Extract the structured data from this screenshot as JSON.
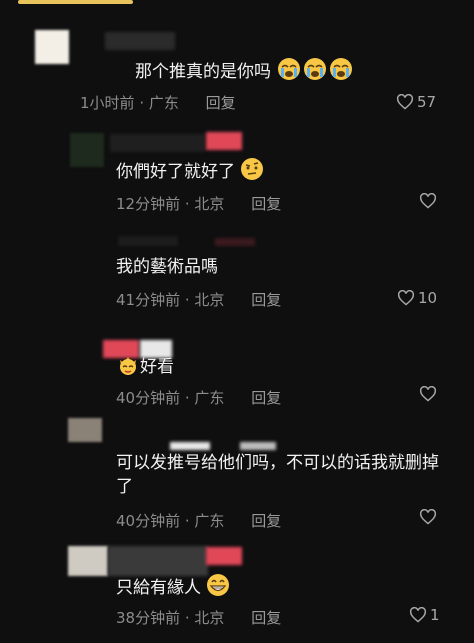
{
  "comments": [
    {
      "text": "那个推真的是你吗",
      "meta_time": "1小时前",
      "meta_location": "· 广东",
      "reply_label": "回复",
      "likes": "57"
    },
    {
      "text": "你們好了就好了",
      "meta_time": "12分钟前",
      "meta_location": "· 北京",
      "reply_label": "回复",
      "likes": ""
    },
    {
      "text": "我的藝術品嗎",
      "meta_time": "41分钟前",
      "meta_location": "· 北京",
      "reply_label": "回复",
      "likes": "10"
    },
    {
      "text": "好看",
      "meta_time": "40分钟前",
      "meta_location": "· 广东",
      "reply_label": "回复",
      "likes": ""
    },
    {
      "text_line1": "可以发推号给他们吗，不可以的话我就删掉",
      "text_line2": "了",
      "meta_time": "40分钟前",
      "meta_location": "· 广东",
      "reply_label": "回复",
      "likes": ""
    },
    {
      "text": "只給有緣人",
      "meta_time": "38分钟前",
      "meta_location": "· 北京",
      "reply_label": "回复",
      "likes": "1"
    }
  ],
  "icons": {
    "emoji_crying": "crying-face-icon",
    "emoji_raised_eyebrow": "raised-eyebrow-face-icon",
    "emoji_grinning": "grinning-face-icon",
    "emoji_crown": "crown-face-icon",
    "heart": "heart-outline-icon"
  },
  "colors": {
    "background": "#0f0f10",
    "text": "#f2f2f2",
    "meta": "#8c8c8c",
    "accent_bar": "#e8c25a"
  }
}
